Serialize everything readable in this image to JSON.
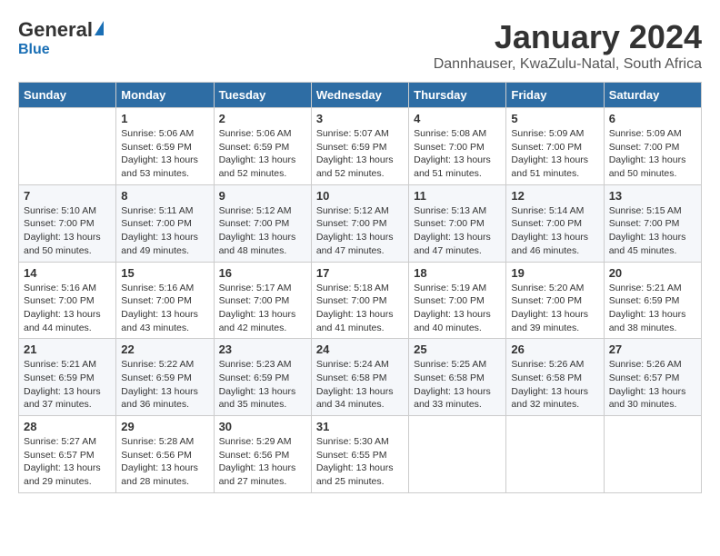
{
  "logo": {
    "general": "General",
    "blue": "Blue"
  },
  "title": "January 2024",
  "location": "Dannhauser, KwaZulu-Natal, South Africa",
  "headers": [
    "Sunday",
    "Monday",
    "Tuesday",
    "Wednesday",
    "Thursday",
    "Friday",
    "Saturday"
  ],
  "weeks": [
    [
      {
        "day": "",
        "info": ""
      },
      {
        "day": "1",
        "info": "Sunrise: 5:06 AM\nSunset: 6:59 PM\nDaylight: 13 hours\nand 53 minutes."
      },
      {
        "day": "2",
        "info": "Sunrise: 5:06 AM\nSunset: 6:59 PM\nDaylight: 13 hours\nand 52 minutes."
      },
      {
        "day": "3",
        "info": "Sunrise: 5:07 AM\nSunset: 6:59 PM\nDaylight: 13 hours\nand 52 minutes."
      },
      {
        "day": "4",
        "info": "Sunrise: 5:08 AM\nSunset: 7:00 PM\nDaylight: 13 hours\nand 51 minutes."
      },
      {
        "day": "5",
        "info": "Sunrise: 5:09 AM\nSunset: 7:00 PM\nDaylight: 13 hours\nand 51 minutes."
      },
      {
        "day": "6",
        "info": "Sunrise: 5:09 AM\nSunset: 7:00 PM\nDaylight: 13 hours\nand 50 minutes."
      }
    ],
    [
      {
        "day": "7",
        "info": "Sunrise: 5:10 AM\nSunset: 7:00 PM\nDaylight: 13 hours\nand 50 minutes."
      },
      {
        "day": "8",
        "info": "Sunrise: 5:11 AM\nSunset: 7:00 PM\nDaylight: 13 hours\nand 49 minutes."
      },
      {
        "day": "9",
        "info": "Sunrise: 5:12 AM\nSunset: 7:00 PM\nDaylight: 13 hours\nand 48 minutes."
      },
      {
        "day": "10",
        "info": "Sunrise: 5:12 AM\nSunset: 7:00 PM\nDaylight: 13 hours\nand 47 minutes."
      },
      {
        "day": "11",
        "info": "Sunrise: 5:13 AM\nSunset: 7:00 PM\nDaylight: 13 hours\nand 47 minutes."
      },
      {
        "day": "12",
        "info": "Sunrise: 5:14 AM\nSunset: 7:00 PM\nDaylight: 13 hours\nand 46 minutes."
      },
      {
        "day": "13",
        "info": "Sunrise: 5:15 AM\nSunset: 7:00 PM\nDaylight: 13 hours\nand 45 minutes."
      }
    ],
    [
      {
        "day": "14",
        "info": "Sunrise: 5:16 AM\nSunset: 7:00 PM\nDaylight: 13 hours\nand 44 minutes."
      },
      {
        "day": "15",
        "info": "Sunrise: 5:16 AM\nSunset: 7:00 PM\nDaylight: 13 hours\nand 43 minutes."
      },
      {
        "day": "16",
        "info": "Sunrise: 5:17 AM\nSunset: 7:00 PM\nDaylight: 13 hours\nand 42 minutes."
      },
      {
        "day": "17",
        "info": "Sunrise: 5:18 AM\nSunset: 7:00 PM\nDaylight: 13 hours\nand 41 minutes."
      },
      {
        "day": "18",
        "info": "Sunrise: 5:19 AM\nSunset: 7:00 PM\nDaylight: 13 hours\nand 40 minutes."
      },
      {
        "day": "19",
        "info": "Sunrise: 5:20 AM\nSunset: 7:00 PM\nDaylight: 13 hours\nand 39 minutes."
      },
      {
        "day": "20",
        "info": "Sunrise: 5:21 AM\nSunset: 6:59 PM\nDaylight: 13 hours\nand 38 minutes."
      }
    ],
    [
      {
        "day": "21",
        "info": "Sunrise: 5:21 AM\nSunset: 6:59 PM\nDaylight: 13 hours\nand 37 minutes."
      },
      {
        "day": "22",
        "info": "Sunrise: 5:22 AM\nSunset: 6:59 PM\nDaylight: 13 hours\nand 36 minutes."
      },
      {
        "day": "23",
        "info": "Sunrise: 5:23 AM\nSunset: 6:59 PM\nDaylight: 13 hours\nand 35 minutes."
      },
      {
        "day": "24",
        "info": "Sunrise: 5:24 AM\nSunset: 6:58 PM\nDaylight: 13 hours\nand 34 minutes."
      },
      {
        "day": "25",
        "info": "Sunrise: 5:25 AM\nSunset: 6:58 PM\nDaylight: 13 hours\nand 33 minutes."
      },
      {
        "day": "26",
        "info": "Sunrise: 5:26 AM\nSunset: 6:58 PM\nDaylight: 13 hours\nand 32 minutes."
      },
      {
        "day": "27",
        "info": "Sunrise: 5:26 AM\nSunset: 6:57 PM\nDaylight: 13 hours\nand 30 minutes."
      }
    ],
    [
      {
        "day": "28",
        "info": "Sunrise: 5:27 AM\nSunset: 6:57 PM\nDaylight: 13 hours\nand 29 minutes."
      },
      {
        "day": "29",
        "info": "Sunrise: 5:28 AM\nSunset: 6:56 PM\nDaylight: 13 hours\nand 28 minutes."
      },
      {
        "day": "30",
        "info": "Sunrise: 5:29 AM\nSunset: 6:56 PM\nDaylight: 13 hours\nand 27 minutes."
      },
      {
        "day": "31",
        "info": "Sunrise: 5:30 AM\nSunset: 6:55 PM\nDaylight: 13 hours\nand 25 minutes."
      },
      {
        "day": "",
        "info": ""
      },
      {
        "day": "",
        "info": ""
      },
      {
        "day": "",
        "info": ""
      }
    ]
  ]
}
